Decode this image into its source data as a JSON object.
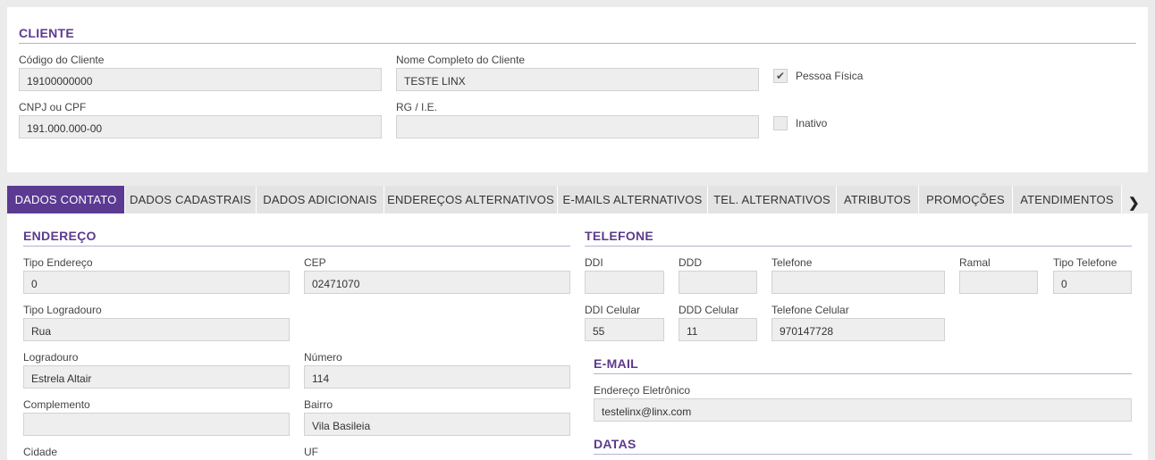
{
  "cliente": {
    "title": "CLIENTE",
    "codigo_label": "Código do Cliente",
    "codigo_value": "19100000000",
    "nome_label": "Nome Completo do Cliente",
    "nome_value": "TESTE LINX",
    "pessoa_fisica_label": "Pessoa Física",
    "pessoa_fisica_checked": true,
    "cnpj_label": "CNPJ ou CPF",
    "cnpj_value": "191.000.000-00",
    "rg_label": "RG / I.E.",
    "rg_value": "",
    "inativo_label": "Inativo",
    "inativo_checked": false
  },
  "tabs": [
    {
      "label": "DADOS CONTATO",
      "active": true
    },
    {
      "label": "DADOS CADASTRAIS",
      "active": false
    },
    {
      "label": "DADOS ADICIONAIS",
      "active": false
    },
    {
      "label": "ENDEREÇOS ALTERNATIVOS",
      "active": false
    },
    {
      "label": "E-MAILS ALTERNATIVOS",
      "active": false
    },
    {
      "label": "TEL. ALTERNATIVOS",
      "active": false
    },
    {
      "label": "ATRIBUTOS",
      "active": false
    },
    {
      "label": "PROMOÇÕES",
      "active": false
    },
    {
      "label": "ATENDIMENTOS",
      "active": false
    }
  ],
  "tab_next_icon": "chevron-right-icon",
  "endereco": {
    "title": "ENDEREÇO",
    "tipo_endereco_label": "Tipo Endereço",
    "tipo_endereco_value": "0",
    "cep_label": "CEP",
    "cep_value": "02471070",
    "tipo_logradouro_label": "Tipo Logradouro",
    "tipo_logradouro_value": "Rua",
    "logradouro_label": "Logradouro",
    "logradouro_value": "Estrela Altair",
    "numero_label": "Número",
    "numero_value": "114",
    "complemento_label": "Complemento",
    "complemento_value": "",
    "bairro_label": "Bairro",
    "bairro_value": "Vila Basileia",
    "cidade_label": "Cidade",
    "uf_label": "UF"
  },
  "telefone": {
    "title": "TELEFONE",
    "ddi_label": "DDI",
    "ddi_value": "",
    "ddd_label": "DDD",
    "ddd_value": "",
    "telefone_label": "Telefone",
    "telefone_value": "",
    "ramal_label": "Ramal",
    "ramal_value": "",
    "tipo_telefone_label": "Tipo Telefone",
    "tipo_telefone_value": "0",
    "ddi_celular_label": "DDI Celular",
    "ddi_celular_value": "55",
    "ddd_celular_label": "DDD Celular",
    "ddd_celular_value": "11",
    "telefone_celular_label": "Telefone Celular",
    "telefone_celular_value": "970147728"
  },
  "email": {
    "title": "E-MAIL",
    "endereco_label": "Endereço Eletrônico",
    "endereco_value": "testelinx@linx.com"
  },
  "datas": {
    "title": "DATAS"
  },
  "colors": {
    "accent": "#5b3a92",
    "title": "#5c3a8e",
    "tab_inactive": "#e3e3e3",
    "field_bg": "#eeeeee"
  }
}
